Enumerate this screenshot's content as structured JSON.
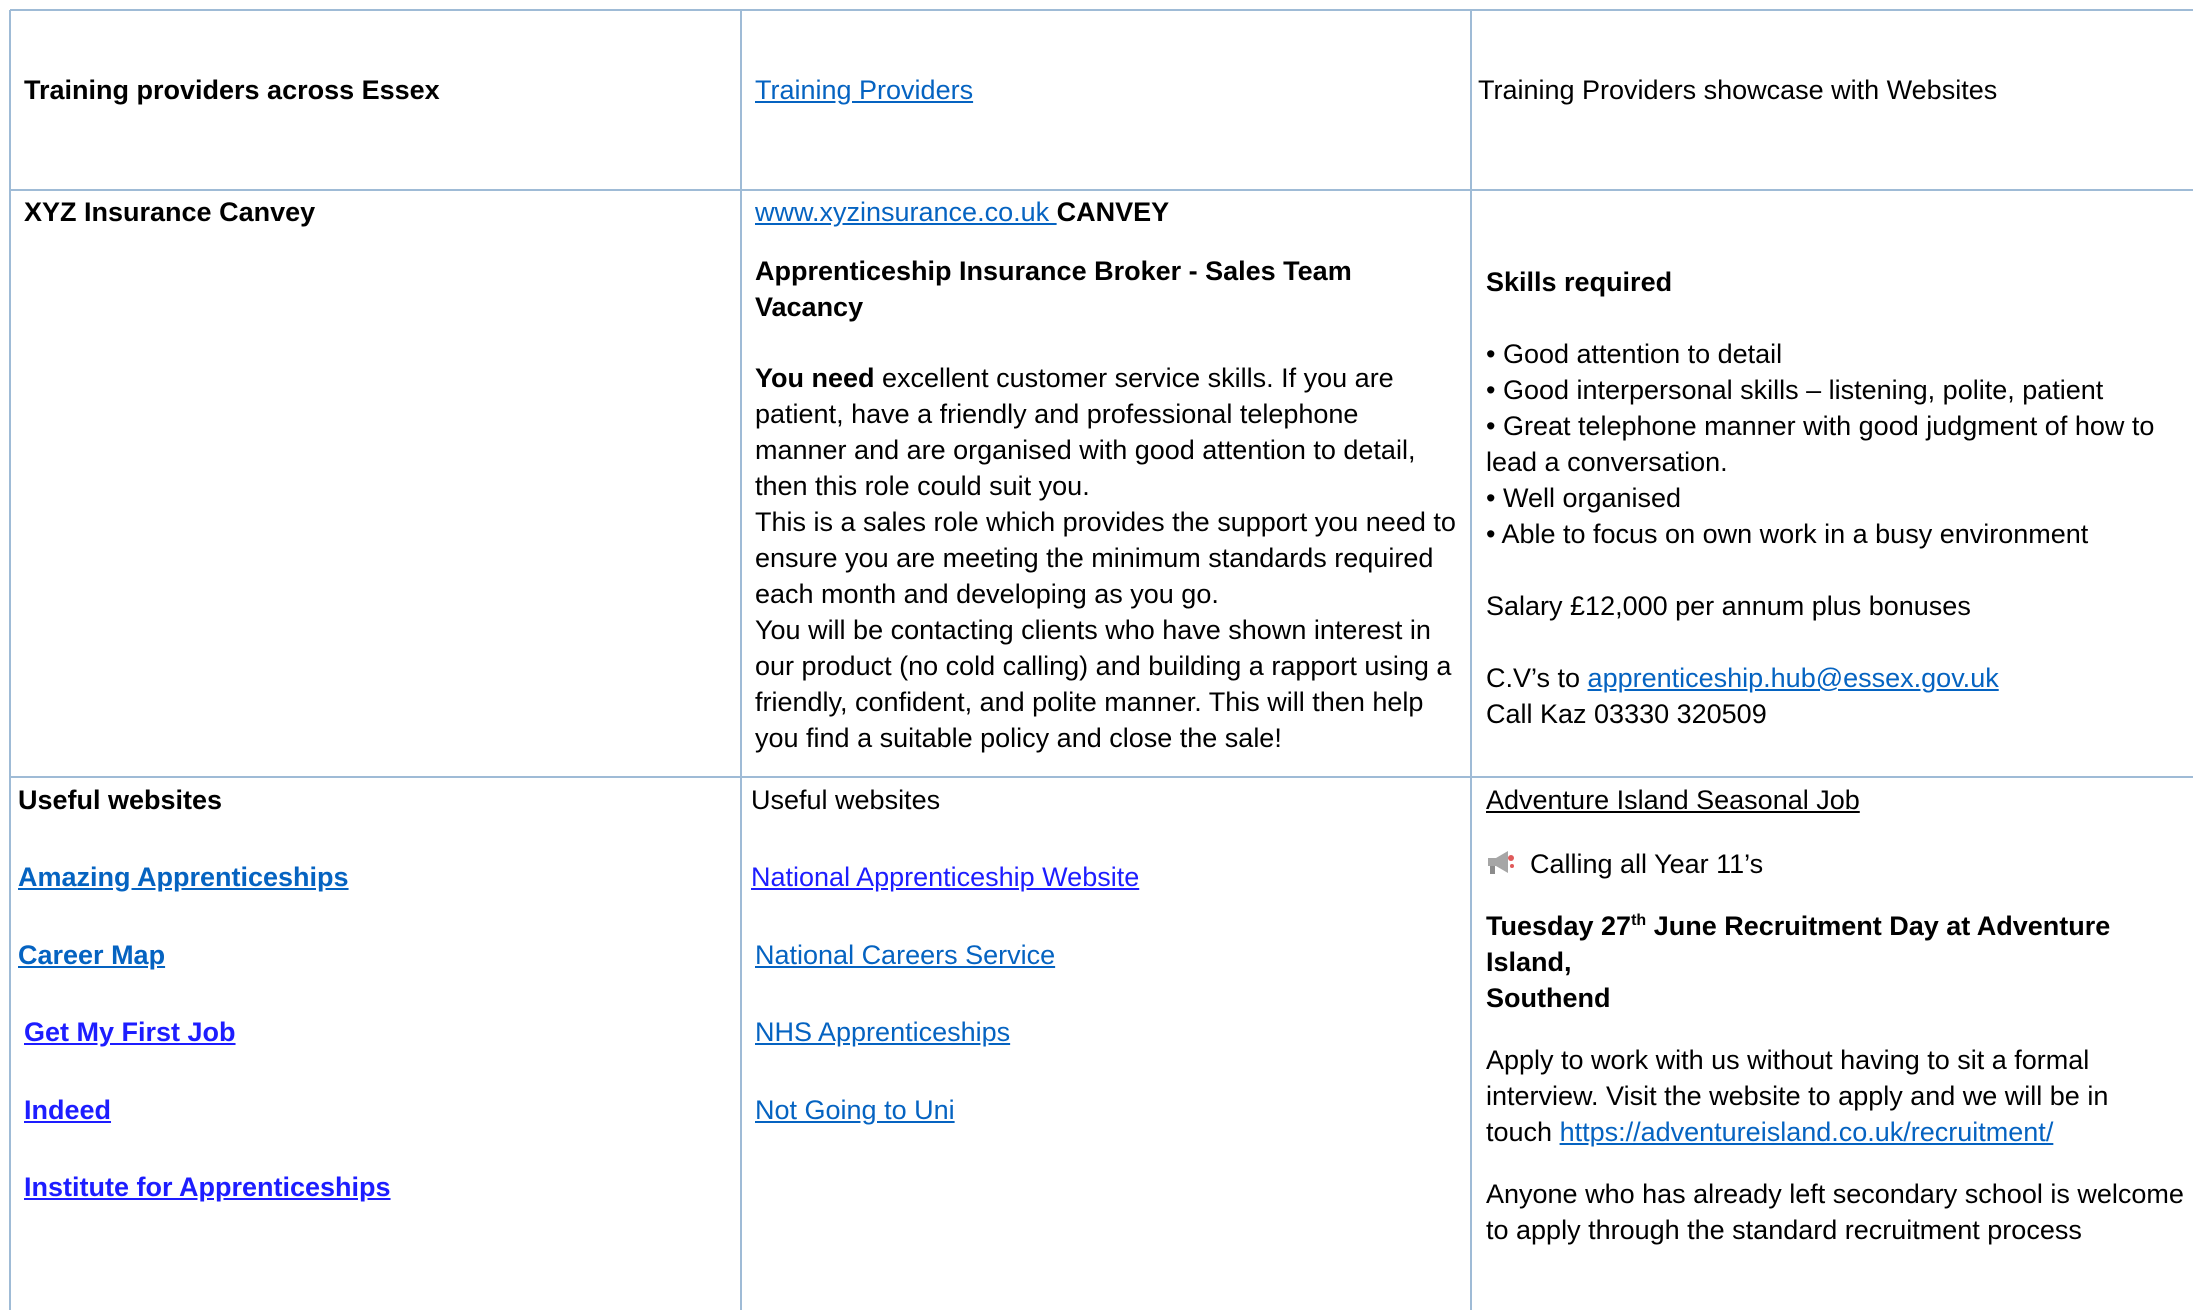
{
  "row1": {
    "col1": "Training providers across Essex",
    "col2_link": "Training Providers",
    "col3": "Training Providers showcase with Websites"
  },
  "row2": {
    "col1": "XYZ Insurance Canvey",
    "website_link": "www.xyzinsurance.co.uk ",
    "location": "CANVEY",
    "vacancy_title": "Apprenticeship Insurance Broker - Sales Team Vacancy",
    "you_need_bold": "You need",
    "desc_lines": [
      " excellent customer service skills. If you are",
      "patient, have a friendly and professional telephone",
      "manner and are organised with good attention to detail,",
      "then this role could suit you.",
      "This is a sales role which provides the support you need to",
      "ensure you are meeting the minimum standards required",
      "each month and developing as you go.",
      "You will be contacting clients who have shown interest in",
      "our product (no cold calling) and building a rapport using a",
      "friendly, confident, and polite manner. This will then help",
      "you find a suitable policy and close the sale!"
    ],
    "skills_heading": "Skills required",
    "skills": [
      "• Good attention to detail",
      "• Good interpersonal skills – listening, polite, patient",
      "• Great telephone manner with good judgment of how to",
      "lead a conversation.",
      "• Well organised",
      "• Able to focus on own work in a busy environment"
    ],
    "salary": "Salary £12,000 per annum plus bonuses",
    "cv_prefix": "C.V’s to ",
    "cv_email": "apprenticeship.hub@essex.gov.uk",
    "call": "Call Kaz 03330 320509"
  },
  "row3": {
    "col1_heading": "Useful websites",
    "col1_links": [
      "Amazing Apprenticeships",
      "Career Map",
      "Get My First Job",
      "Indeed",
      "Institute for Apprenticeships"
    ],
    "col2_heading": "Useful websites",
    "col2_links": [
      "National Apprenticeship Website",
      "National Careers Service",
      "NHS Apprenticeships",
      "Not Going to Uni"
    ],
    "col3_heading": "Adventure Island Seasonal Job",
    "calling": "Calling all Year 11’s",
    "event_a": "Tuesday 27",
    "event_sup": "th",
    "event_b": " June Recruitment Day at Adventure Island,",
    "event_c": "Southend",
    "apply_lines": [
      "Apply to work with us without having to sit a formal",
      "interview.  Visit the website to apply and we will be in"
    ],
    "apply_prefix": "touch ",
    "apply_link": "https://adventureisland.co.uk/recruitment/",
    "anyone_lines": [
      "Anyone who has already left secondary school is welcome",
      "to apply through the standard recruitment process"
    ]
  }
}
